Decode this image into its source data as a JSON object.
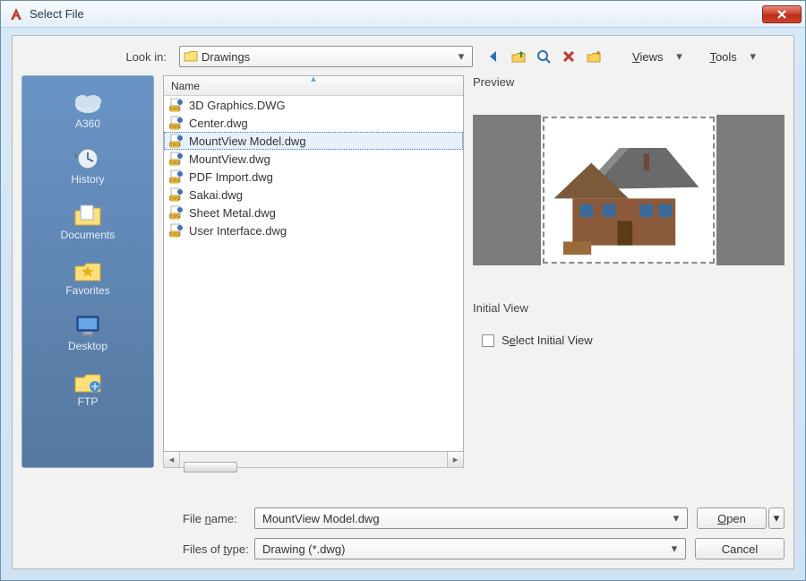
{
  "window": {
    "title": "Select File"
  },
  "lookIn": {
    "label": "Look in:",
    "value": "Drawings"
  },
  "toolbarIcons": {
    "back": "back-arrow-icon",
    "up": "up-folder-icon",
    "search": "search-web-icon",
    "delete": "delete-x-icon",
    "newfolder": "new-folder-icon"
  },
  "menus": {
    "views": "Views",
    "tools": "Tools"
  },
  "sidebar": {
    "items": [
      {
        "label": "A360",
        "icon": "cloud-icon"
      },
      {
        "label": "History",
        "icon": "history-icon"
      },
      {
        "label": "Documents",
        "icon": "documents-folder-icon"
      },
      {
        "label": "Favorites",
        "icon": "favorites-folder-icon"
      },
      {
        "label": "Desktop",
        "icon": "desktop-monitor-icon"
      },
      {
        "label": "FTP",
        "icon": "ftp-folder-icon"
      }
    ]
  },
  "fileList": {
    "header": "Name",
    "files": [
      {
        "name": "3D Graphics.DWG",
        "selected": false
      },
      {
        "name": "Center.dwg",
        "selected": false
      },
      {
        "name": "MountView Model.dwg",
        "selected": true
      },
      {
        "name": "MountView.dwg",
        "selected": false
      },
      {
        "name": "PDF Import.dwg",
        "selected": false
      },
      {
        "name": "Sakai.dwg",
        "selected": false
      },
      {
        "name": "Sheet Metal.dwg",
        "selected": false
      },
      {
        "name": "User Interface.dwg",
        "selected": false
      }
    ]
  },
  "preview": {
    "label": "Preview"
  },
  "initialView": {
    "label": "Initial View",
    "checkboxLabel": "Select Initial View",
    "checked": false
  },
  "fileName": {
    "label": "File name:",
    "value": "MountView Model.dwg"
  },
  "filesOfType": {
    "label": "Files of type:",
    "value": "Drawing (*.dwg)"
  },
  "buttons": {
    "open": "Open",
    "cancel": "Cancel"
  }
}
